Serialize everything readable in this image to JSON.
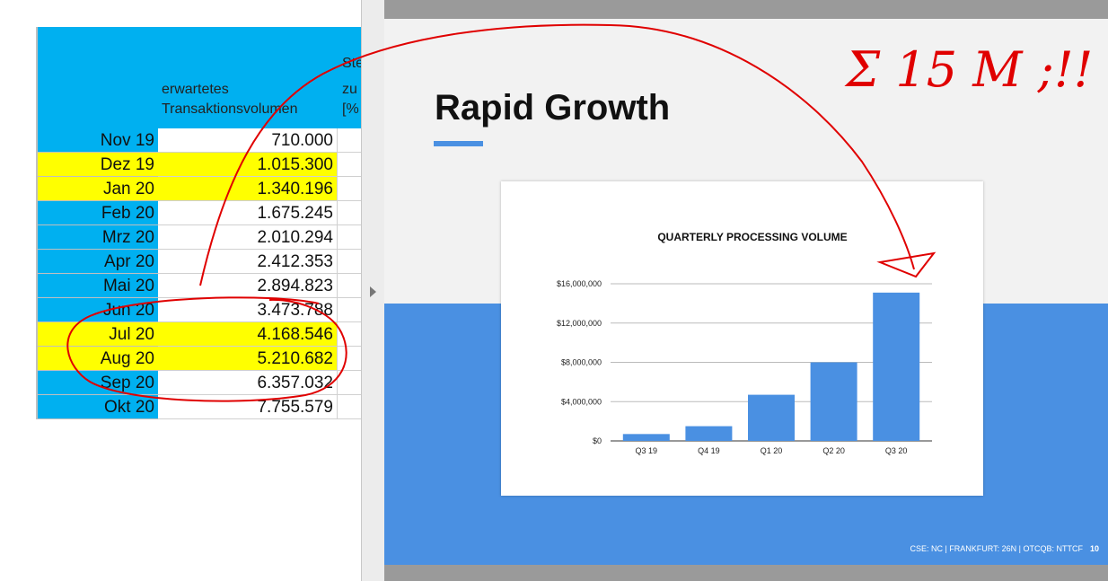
{
  "spreadsheet": {
    "header": {
      "col_b_line1": "erwartetes",
      "col_b_line2": "Transaktionsvolumen",
      "col_c_line1": "Ste",
      "col_c_line2": "zu",
      "col_c_line3": "[%"
    },
    "rows": [
      {
        "month": "Nov 19",
        "value": "710.000",
        "highlight": false
      },
      {
        "month": "Dez 19",
        "value": "1.015.300",
        "highlight": true
      },
      {
        "month": "Jan 20",
        "value": "1.340.196",
        "highlight": true
      },
      {
        "month": "Feb 20",
        "value": "1.675.245",
        "highlight": false
      },
      {
        "month": "Mrz 20",
        "value": "2.010.294",
        "highlight": false
      },
      {
        "month": "Apr 20",
        "value": "2.412.353",
        "highlight": false
      },
      {
        "month": "Mai 20",
        "value": "2.894.823",
        "highlight": false
      },
      {
        "month": "Jun 20",
        "value": "3.473.788",
        "highlight": false
      },
      {
        "month": "Jul 20",
        "value": "4.168.546",
        "highlight": true
      },
      {
        "month": "Aug 20",
        "value": "5.210.682",
        "highlight": true
      },
      {
        "month": "Sep 20",
        "value": "6.357.032",
        "highlight": false
      },
      {
        "month": "Okt 20",
        "value": "7.755.579",
        "highlight": false
      }
    ],
    "colors": {
      "header": "#00b0f0",
      "highlight": "#ffff00"
    }
  },
  "slide": {
    "title": "Rapid Growth",
    "footer": "CSE: NC  |  FRANKFURT: 26N  |  OTCQB: NTTCF",
    "page_number": "10",
    "colors": {
      "accent": "#4a90e2",
      "background": "#f2f2f2"
    }
  },
  "annotation": {
    "text": "Σ 15 M ;!!",
    "color": "#e00000"
  },
  "chart_data": {
    "type": "bar",
    "title": "QUARTERLY PROCESSING VOLUME",
    "categories": [
      "Q3 19",
      "Q4 19",
      "Q1 20",
      "Q2 20",
      "Q3 20"
    ],
    "values": [
      700000,
      1500000,
      4700000,
      8000000,
      15100000
    ],
    "yticks": [
      "$0",
      "$4,000,000",
      "$8,000,000",
      "$12,000,000",
      "$16,000,000"
    ],
    "ylim": [
      0,
      16000000
    ],
    "grid": true,
    "color": "#4a90e2"
  }
}
